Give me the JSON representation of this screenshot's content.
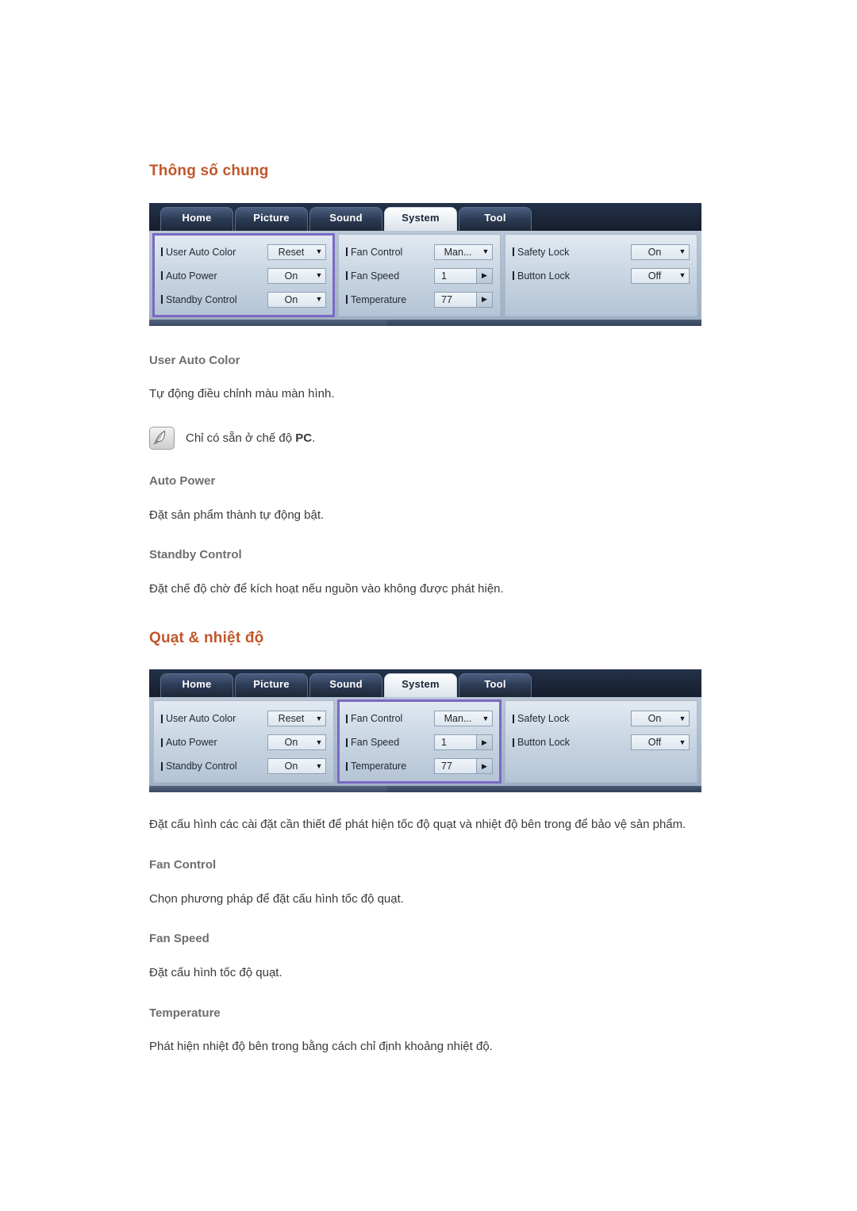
{
  "sections": [
    {
      "heading": "Thông số chung",
      "osd": {
        "tabs": [
          "Home",
          "Picture",
          "Sound",
          "System",
          "Tool"
        ],
        "active_tab": "System",
        "highlight_panel": 0,
        "panels": [
          {
            "rows": [
              {
                "label": "User Auto Color",
                "value": "Reset",
                "control": "dropdown"
              },
              {
                "label": "Auto Power",
                "value": "On",
                "control": "dropdown"
              },
              {
                "label": "Standby Control",
                "value": "On",
                "control": "dropdown"
              }
            ]
          },
          {
            "rows": [
              {
                "label": "Fan Control",
                "value": "Man...",
                "control": "dropdown"
              },
              {
                "label": "Fan Speed",
                "value": "1",
                "control": "spinner"
              },
              {
                "label": "Temperature",
                "value": "77",
                "control": "spinner"
              }
            ]
          },
          {
            "rows": [
              {
                "label": "Safety Lock",
                "value": "On",
                "control": "dropdown"
              },
              {
                "label": "Button Lock",
                "value": "Off",
                "control": "dropdown"
              }
            ]
          }
        ]
      },
      "items": [
        {
          "title": "User Auto Color",
          "text": "Tự động điều chỉnh màu màn hình."
        },
        {
          "title": "Auto Power",
          "text": "Đặt sản phẩm thành tự động bật."
        },
        {
          "title": "Standby Control",
          "text": "Đặt chế độ chờ để kích hoạt nếu nguồn vào không được phát hiện."
        }
      ],
      "note": {
        "icon": "note-pen-icon",
        "text_before": "Chỉ có sẵn ở chế độ ",
        "text_bold": "PC",
        "text_after": "."
      }
    },
    {
      "heading": "Quạt & nhiệt độ",
      "osd": {
        "tabs": [
          "Home",
          "Picture",
          "Sound",
          "System",
          "Tool"
        ],
        "active_tab": "System",
        "highlight_panel": 1,
        "panels": [
          {
            "rows": [
              {
                "label": "User Auto Color",
                "value": "Reset",
                "control": "dropdown"
              },
              {
                "label": "Auto Power",
                "value": "On",
                "control": "dropdown"
              },
              {
                "label": "Standby Control",
                "value": "On",
                "control": "dropdown"
              }
            ]
          },
          {
            "rows": [
              {
                "label": "Fan Control",
                "value": "Man...",
                "control": "dropdown"
              },
              {
                "label": "Fan Speed",
                "value": "1",
                "control": "spinner"
              },
              {
                "label": "Temperature",
                "value": "77",
                "control": "spinner"
              }
            ]
          },
          {
            "rows": [
              {
                "label": "Safety Lock",
                "value": "On",
                "control": "dropdown"
              },
              {
                "label": "Button Lock",
                "value": "Off",
                "control": "dropdown"
              }
            ]
          }
        ]
      },
      "intro": "Đặt cấu hình các cài đặt cần thiết để phát hiện tốc độ quạt và nhiệt độ bên trong để bảo vệ sản phẩm.",
      "items": [
        {
          "title": "Fan Control",
          "text": "Chọn phương pháp để đặt cấu hình tốc độ quạt."
        },
        {
          "title": "Fan Speed",
          "text": "Đặt cấu hình tốc độ quạt."
        },
        {
          "title": "Temperature",
          "text": "Phát hiện nhiệt độ bên trong bằng cách chỉ định khoảng nhiệt độ."
        }
      ]
    }
  ],
  "colors": {
    "heading": "#c1572b",
    "sub_heading": "#6e6e6e",
    "body": "#3a3a3a",
    "osd_highlight": "#7a69c4"
  }
}
